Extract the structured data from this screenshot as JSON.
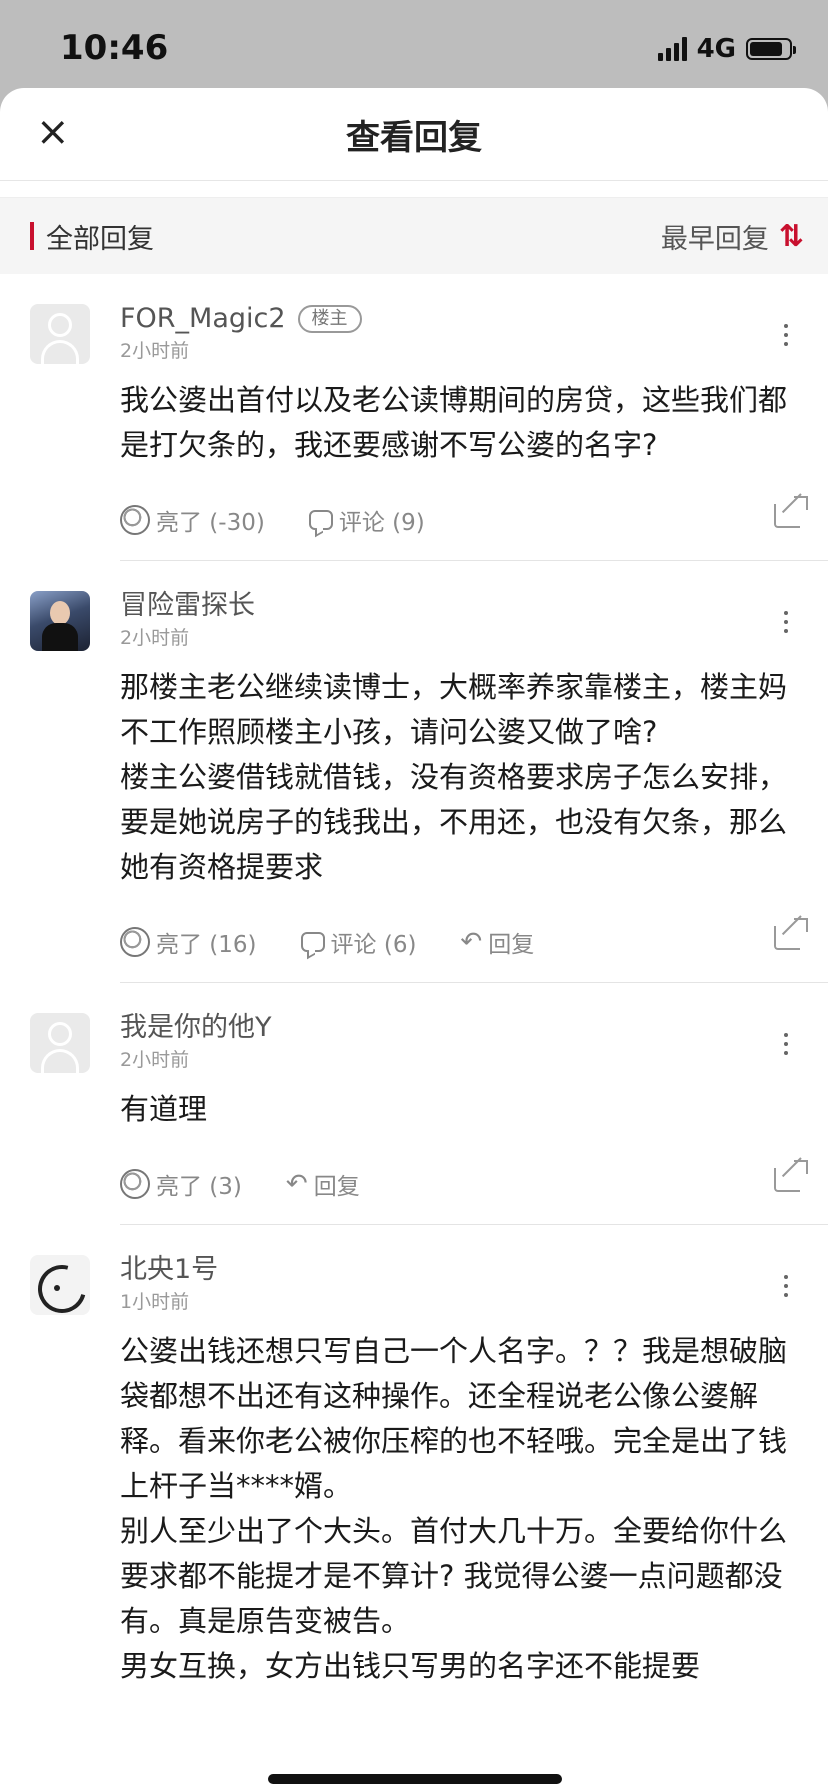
{
  "status_bar": {
    "time": "10:46",
    "network": "4G"
  },
  "header": {
    "close_icon": "×",
    "title": "查看回复"
  },
  "filter": {
    "left_label": "全部回复",
    "sort_label": "最早回复",
    "sort_icon": "⇅"
  },
  "posts": [
    {
      "username": "FOR_Magic2",
      "badge": "楼主",
      "time": "2小时前",
      "avatar": "default-avatar",
      "paragraphs": [
        "我公婆出首付以及老公读博期间的房贷，这些我们都是打欠条的，我还要感谢不写公婆的名字?"
      ],
      "like_label": "亮了 (-30)",
      "comment_label": "评论 (9)"
    },
    {
      "username": "冒险雷探长",
      "time": "2小时前",
      "avatar": "photo-avatar",
      "paragraphs": [
        "那楼主老公继续读博士，大概率养家靠楼主，楼主妈不工作照顾楼主小孩，请问公婆又做了啥?",
        "楼主公婆借钱就借钱，没有资格要求房子怎么安排，要是她说房子的钱我出，不用还，也没有欠条，那么她有资格提要求"
      ],
      "like_label": "亮了 (16)",
      "comment_label": "评论 (6)",
      "reply_label": "回复"
    },
    {
      "username": "我是你的他Y",
      "time": "2小时前",
      "avatar": "default-avatar",
      "paragraphs": [
        "有道理"
      ],
      "like_label": "亮了 (3)",
      "reply_label": "回复"
    },
    {
      "username": "北央1号",
      "time": "1小时前",
      "avatar": "ink-avatar",
      "paragraphs": [
        "公婆出钱还想只写自己一个人名字。？？我是想破脑袋都想不出还有这种操作。还全程说老公像公婆解释。看来你老公被你压榨的也不轻哦。完全是出了钱上杆子当****婿。",
        "别人至少出了个大头。首付大几十万。全要给你什么要求都不能提才是不算计? 我觉得公婆一点问题都没有。真是原告变被告。",
        "男女互换，女方出钱只写男的名字还不能提要"
      ]
    }
  ]
}
